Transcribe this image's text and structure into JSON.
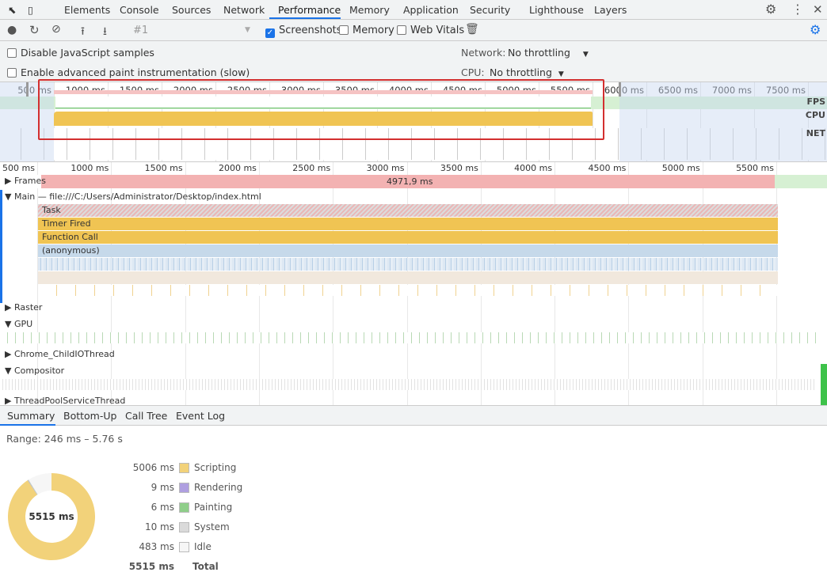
{
  "tabs": [
    "Elements",
    "Console",
    "Sources",
    "Network",
    "Performance",
    "Memory",
    "Application",
    "Security",
    "Lighthouse",
    "Layers"
  ],
  "active_tab": "Performance",
  "toolbar": {
    "profile_select": "#1",
    "screenshots_label": "Screenshots",
    "screenshots_checked": true,
    "memory_label": "Memory",
    "memory_checked": false,
    "web_vitals_label": "Web Vitals",
    "web_vitals_checked": false
  },
  "settings": {
    "disable_js_samples": "Disable JavaScript samples",
    "advanced_paint": "Enable advanced paint instrumentation (slow)",
    "network_label": "Network:",
    "network_value": "No throttling",
    "cpu_label": "CPU:",
    "cpu_value": "No throttling"
  },
  "overview": {
    "ticks": [
      "500 ms",
      "1000 ms",
      "1500 ms",
      "2000 ms",
      "2500 ms",
      "3000 ms",
      "3500 ms",
      "4000 ms",
      "4500 ms",
      "5000 ms",
      "5500 ms",
      "6000 ms",
      "6500 ms",
      "7000 ms",
      "7500 ms"
    ],
    "tracks": [
      "FPS",
      "CPU",
      "NET"
    ]
  },
  "timeline": {
    "ticks": [
      "500 ms",
      "1000 ms",
      "1500 ms",
      "2000 ms",
      "2500 ms",
      "3000 ms",
      "3500 ms",
      "4000 ms",
      "4500 ms",
      "5000 ms",
      "5500 ms"
    ],
    "frames_label": "Frames",
    "frames_value": "4971,9 ms",
    "main_label": "Main — file:///C:/Users/Administrator/Desktop/index.html",
    "events": [
      "Task",
      "Timer Fired",
      "Function Call",
      "(anonymous)"
    ],
    "sections": [
      "Raster",
      "GPU",
      "Chrome_ChildIOThread",
      "Compositor",
      "ThreadPoolServiceThread"
    ]
  },
  "bottom_tabs": [
    "Summary",
    "Bottom-Up",
    "Call Tree",
    "Event Log"
  ],
  "summary": {
    "range": "Range: 246 ms – 5.76 s",
    "total_center": "5515 ms",
    "items": [
      {
        "ms": "5006 ms",
        "label": "Scripting",
        "color": "#f2d27a",
        "value": 5006
      },
      {
        "ms": "9 ms",
        "label": "Rendering",
        "color": "#af9fe0",
        "value": 9
      },
      {
        "ms": "6 ms",
        "label": "Painting",
        "color": "#8fce8a",
        "value": 6
      },
      {
        "ms": "10 ms",
        "label": "System",
        "color": "#dadada",
        "value": 10
      },
      {
        "ms": "483 ms",
        "label": "Idle",
        "color": "#f6f6f6",
        "value": 483
      }
    ],
    "total_ms": "5515 ms",
    "total_label": "Total"
  },
  "colors": {
    "accent": "#1a73e8",
    "scripting": "#f0c453",
    "frames": "#f3b2b2",
    "anonymous": "#c6d9ea",
    "highlight": "#d32f2f"
  }
}
